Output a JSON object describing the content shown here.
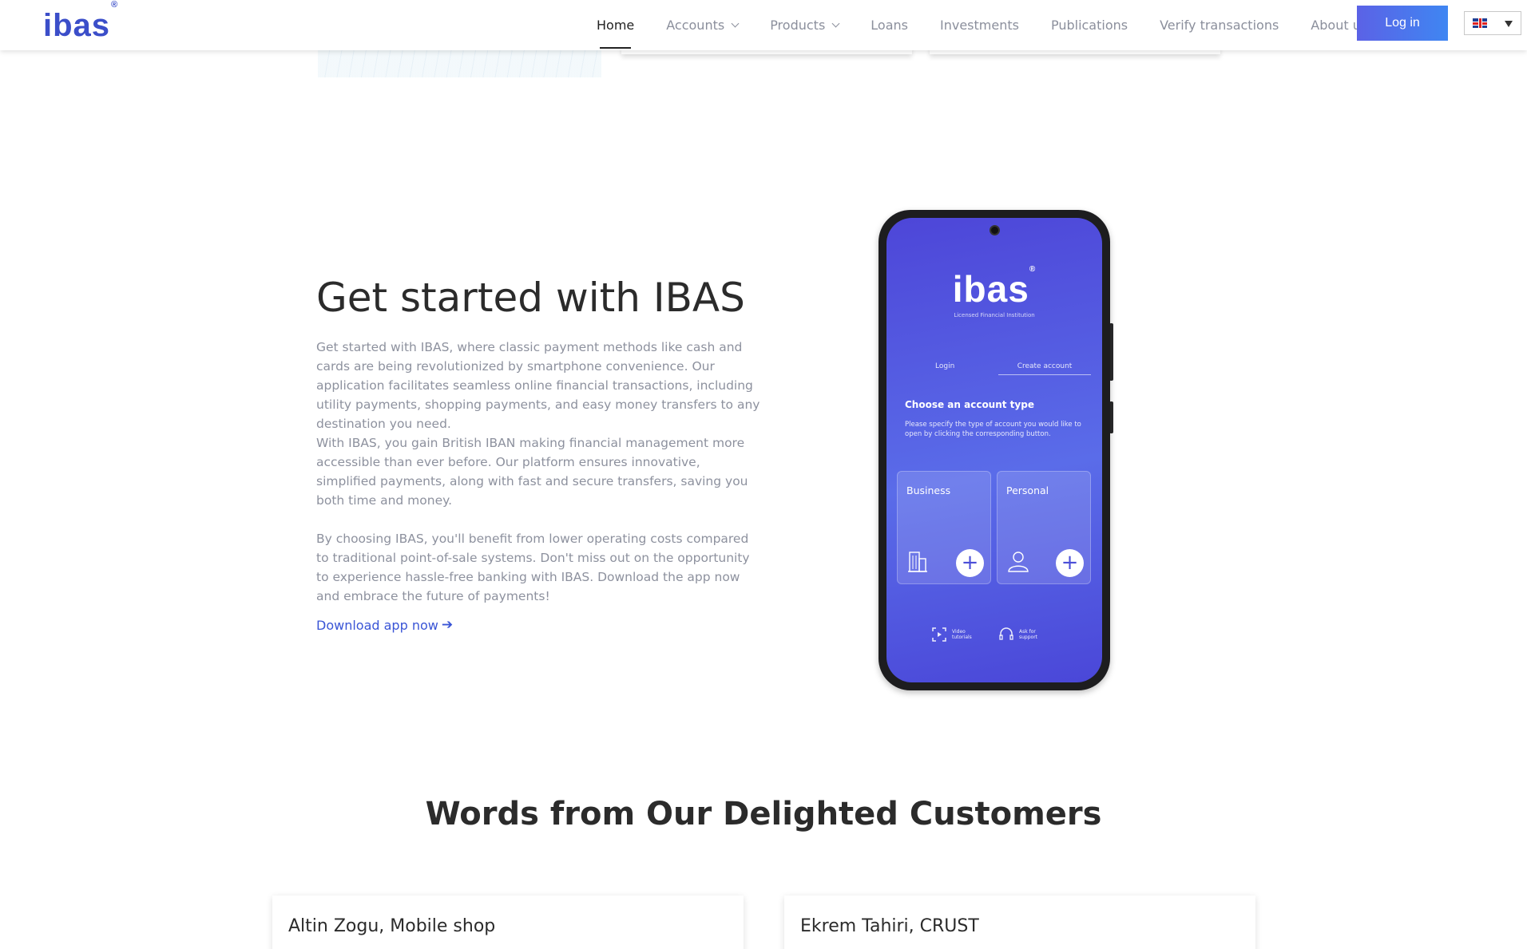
{
  "brand": {
    "logo_text": "ibas",
    "logo_mark": "®",
    "color": "#3b4ec9"
  },
  "nav": {
    "items": [
      {
        "label": "Home",
        "active": true,
        "dropdown": false
      },
      {
        "label": "Accounts",
        "active": false,
        "dropdown": true
      },
      {
        "label": "Products",
        "active": false,
        "dropdown": true
      },
      {
        "label": "Loans",
        "active": false,
        "dropdown": false
      },
      {
        "label": "Investments",
        "active": false,
        "dropdown": false
      },
      {
        "label": "Publications",
        "active": false,
        "dropdown": false
      },
      {
        "label": "Verify transactions",
        "active": false,
        "dropdown": false
      },
      {
        "label": "About us",
        "active": false,
        "dropdown": true
      }
    ],
    "login_label": "Log in",
    "language": {
      "flag": "uk-flag-icon",
      "caret": "caret-down-icon"
    }
  },
  "get_started": {
    "title": "Get started with IBAS",
    "paragraphs": [
      "Get started with IBAS, where classic payment methods like cash and cards are being revolutionized by smartphone convenience. Our application facilitates seamless online financial transactions, including utility payments, shopping payments, and easy money transfers to any destination you need.",
      "With IBAS, you gain British IBAN making financial management more accessible than ever before. Our platform ensures innovative, simplified payments, along with fast and secure transfers, saving you both time and money.",
      "By choosing IBAS, you'll benefit from lower operating costs compared to traditional point-of-sale systems. Don't miss out on the opportunity to experience hassle-free banking with IBAS. Download the app now and embrace the future of payments!"
    ],
    "link_label": "Download app now",
    "link_icon": "arrow-right-icon",
    "link_color": "#3a55d6"
  },
  "phone_app": {
    "logo_text": "ibas",
    "logo_mark": "®",
    "subtitle": "Licensed Financial Institution",
    "tab_login": "Login",
    "tab_create": "Create account",
    "heading": "Choose an account type",
    "description": "Please specify the type of account you would like to open by clicking the corresponding button.",
    "cards": [
      {
        "label": "Business",
        "icon": "building-icon"
      },
      {
        "label": "Personal",
        "icon": "person-icon"
      }
    ],
    "footer": [
      {
        "label": "Video tutorials",
        "icon": "video-icon"
      },
      {
        "label": "Ask for support",
        "icon": "headset-icon"
      }
    ]
  },
  "customers": {
    "title": "Words from Our Delighted Customers",
    "cards": [
      {
        "name": "Altin Zogu, Mobile shop"
      },
      {
        "name": "Ekrem Tahiri, CRUST"
      }
    ]
  }
}
